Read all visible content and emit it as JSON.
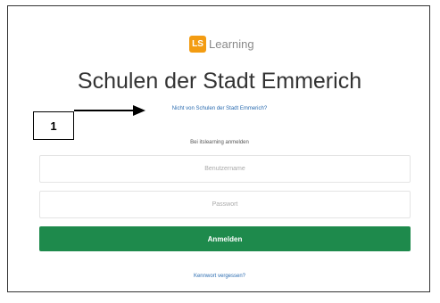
{
  "logo": {
    "mark": "LS",
    "text": "Learning",
    "color": "#f39c12"
  },
  "header": {
    "title": "Schulen der Stadt Emmerich",
    "not_school_link": "Nicht von Schulen der Stadt Emmerich?"
  },
  "annotation": {
    "number": "1"
  },
  "form": {
    "subtitle": "Bei itslearning anmelden",
    "username_placeholder": "Benutzername",
    "password_placeholder": "Passwort",
    "login_label": "Anmelden",
    "forgot_link": "Kennwort vergessen?"
  },
  "colors": {
    "primary_button": "#1e8a4c",
    "link": "#2b6cb0"
  }
}
